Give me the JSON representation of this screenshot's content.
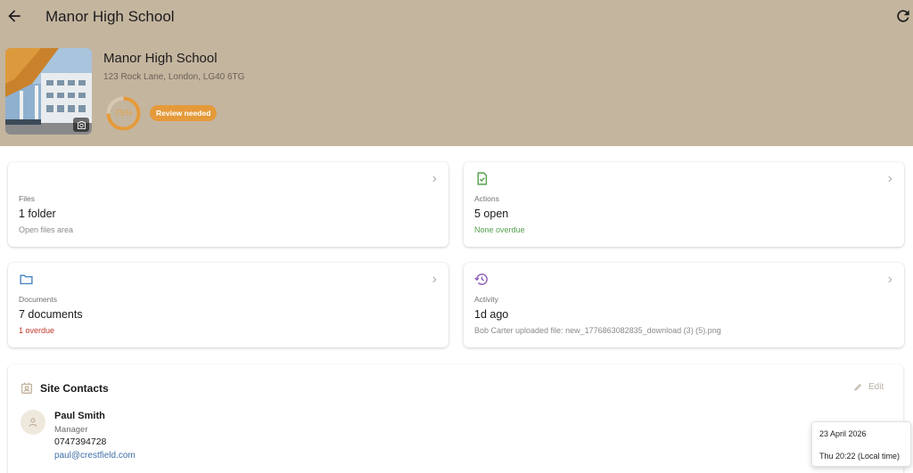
{
  "app_bar": {
    "title": "Manor High School"
  },
  "site": {
    "name": "Manor High School",
    "address": "123 Rock Lane, London, LG40 6TG",
    "progress_percent": 75,
    "progress_label": "75%",
    "status_badge": "Review needed"
  },
  "colors": {
    "header_bg": "#c4b59f",
    "progress": "#e59a3a",
    "badge": "#e59a3a",
    "ok": "#55a04d",
    "overdue": "#c0392b",
    "link": "#3f6fa8"
  },
  "cards": {
    "files": {
      "label": "Files",
      "value": "1 folder",
      "sub": "Open files area"
    },
    "actions": {
      "icon": "clipboard-check-icon",
      "label": "Actions",
      "value": "5 open",
      "sub": "None overdue"
    },
    "documents": {
      "icon": "folder-icon",
      "label": "Documents",
      "value": "7 documents",
      "sub": "1 overdue"
    },
    "activity": {
      "icon": "history-icon",
      "label": "Activity",
      "value": "1d ago",
      "sub": "Bob Carter uploaded file: new_1776863082835_download (3) (5).png"
    }
  },
  "contacts": {
    "title": "Site Contacts",
    "edit_label": "Edit",
    "items": [
      {
        "name": "Paul Smith",
        "role": "Manager",
        "phone": "0747394728",
        "email": "paul@crestfield.com"
      }
    ]
  },
  "tooltip": {
    "date": "23 April 2026",
    "time": "Thu 20:22 (Local time)"
  }
}
